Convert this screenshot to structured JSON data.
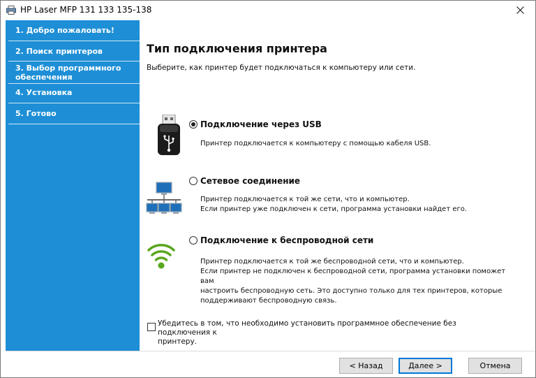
{
  "window": {
    "title": "HP Laser MFP 131 133 135-138"
  },
  "sidebar": {
    "items": [
      {
        "label": "1. Добро пожаловать!"
      },
      {
        "label": "2. Поиск принтеров"
      },
      {
        "label_line1": "3. Выбор программного",
        "label_line2": "обеспечения"
      },
      {
        "label": "4. Установка"
      },
      {
        "label": "5. Готово"
      }
    ]
  },
  "main": {
    "title": "Тип подключения принтера",
    "subtitle": "Выберите, как принтер будет подключаться к компьютеру или сети.",
    "options": [
      {
        "title": "Подключение через USB",
        "selected": true,
        "icon": "usb-icon",
        "desc": [
          "Принтер подключается к компьютеру с помощью кабеля USB."
        ]
      },
      {
        "title": "Сетевое соединение",
        "selected": false,
        "icon": "network-icon",
        "desc": [
          "Принтер подключается к той же сети, что и компьютер.",
          "Если принтер уже подключен к сети, программа установки найдет его."
        ]
      },
      {
        "title": "Подключение к беспроводной сети",
        "selected": false,
        "icon": "wifi-icon",
        "desc": [
          "Принтер подключается к той же беспроводной сети, что и компьютер.",
          "Если принтер не подключен к беспроводной сети, программа установки поможет вам",
          "настроить беспроводную сеть. Это доступно только для тех принтеров, которые",
          "поддерживают беспроводную связь."
        ]
      }
    ],
    "checkbox": {
      "line1": "Убедитесь в том, что необходимо установить программное обеспечение без подключения к",
      "line2": "принтеру.",
      "checked": false
    }
  },
  "footer": {
    "back_label": "< Назад",
    "next_label": "Далее >",
    "cancel_label": "Отмена"
  },
  "colors": {
    "sidebar": "#1e8fd6",
    "accent": "#0078d7",
    "wifi": "#5aa61f"
  }
}
